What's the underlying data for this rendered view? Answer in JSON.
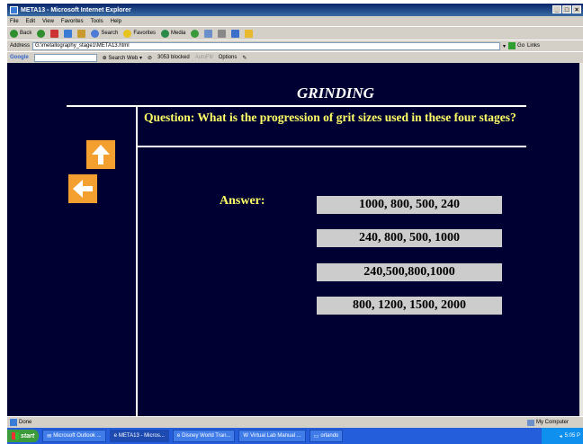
{
  "window": {
    "title": "META13 - Microsoft Internet Explorer",
    "minimize_icon": "minimize-icon",
    "close_icon": "close-icon"
  },
  "menu": [
    "File",
    "Edit",
    "View",
    "Favorites",
    "Tools",
    "Help"
  ],
  "toolbar": {
    "back": "Back",
    "search": "Search",
    "favorites": "Favorites",
    "media": "Media"
  },
  "address": {
    "label": "Address",
    "value": "G:\\metallography_stage1\\META13.html",
    "go": "Go",
    "links": "Links"
  },
  "googlebar": {
    "logo": "Google",
    "search_web": "Search Web",
    "blocked": "3053 blocked",
    "autofill": "AutoFill",
    "options": "Options"
  },
  "page": {
    "title": "GRINDING",
    "question": "Question:  What is the progression of grit sizes used in these four stages?",
    "answer_label": "Answer:",
    "options": [
      "1000, 800, 500, 240",
      "240, 800, 500, 1000",
      "240,500,800,1000",
      "800, 1200, 1500, 2000"
    ],
    "arrow_up_color": "#f4a030",
    "background_color": "#000033",
    "question_color": "#ffff66"
  },
  "status": {
    "text": "Done",
    "zone": "My Computer"
  },
  "taskbar": {
    "start": "start",
    "tasks": [
      "Microsoft Outlook ...",
      "META13 - Micros...",
      "Disney World Tran...",
      "Virtual Lab Manual ...",
      "orlando"
    ],
    "clock": "5:05 P"
  }
}
